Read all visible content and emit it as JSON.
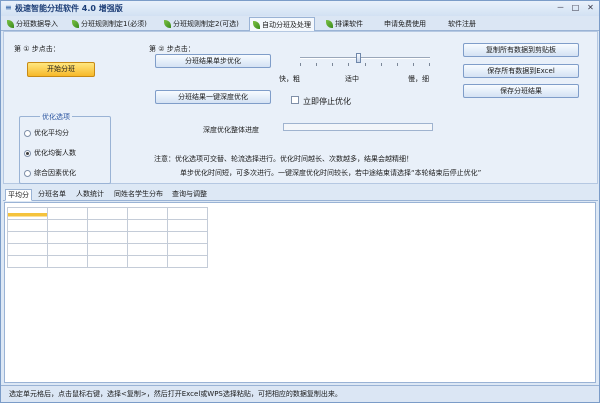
{
  "window": {
    "title": "极速智能分班软件 4.0 增强版",
    "controls": [
      "－",
      "□",
      "✕"
    ]
  },
  "tabs": [
    {
      "label": "分班数据导入",
      "icon": "leaf-icon"
    },
    {
      "label": "分班规则制定1(必须)",
      "icon": "leaf-icon"
    },
    {
      "label": "分班规则制定2(可选)",
      "icon": "leaf-icon"
    },
    {
      "label": "自动分班及处理",
      "icon": "leaf-icon",
      "active": true
    },
    {
      "label": "排课软件",
      "icon": "leaf-icon"
    },
    {
      "label": "申请免费使用",
      "icon": ""
    },
    {
      "label": "软件注册",
      "icon": ""
    }
  ],
  "step1": {
    "label": "第 ① 步点击：",
    "start_button": "开始分班"
  },
  "step2": {
    "label": "第 ② 步点击：",
    "single_step_button": "分班结果单步优化",
    "deep_button": "分班结果一键深度优化",
    "stop_label": "立即停止优化",
    "speed_labels": [
      "快，粗",
      "适中",
      "慢，细"
    ],
    "speed_level": 0.45
  },
  "optimize_group": {
    "title": "优化选项",
    "options": [
      {
        "label": "优化平均分",
        "selected": false
      },
      {
        "label": "优化均衡人数",
        "selected": true
      },
      {
        "label": "综合因素优化",
        "selected": false
      }
    ]
  },
  "export": {
    "copy_all": "复制所有数据到剪贴板",
    "save_excel": "保存所有数据到Excel",
    "save_result": "保存分班结果"
  },
  "progress": {
    "label": "深度优化整体进度",
    "value": 0
  },
  "notes": {
    "line1": "注意：优化选项可交替、轮流选择进行。优化时间越长、次数越多，结果会越精细！",
    "line2": "单步优化时间短，可多次进行。一键深度优化时间较长，若中途结束请选择“本轮结束后停止优化”"
  },
  "result_tabs": [
    "平均分",
    "分班名单",
    "人数统计",
    "同姓名学生分布",
    "查询与调整"
  ],
  "status": "选定单元格后，点击鼠标右键，选择<复制>，然后打开Excel或WPS选择粘贴，可把相应的数据复制出来。"
}
